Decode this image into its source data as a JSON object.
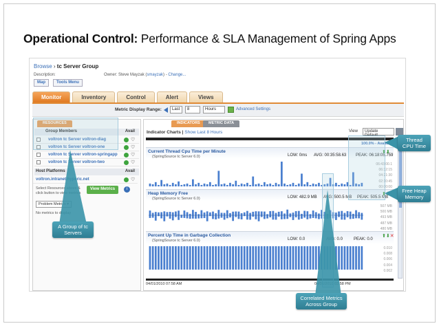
{
  "slide": {
    "title_bold": "Operational Control:",
    "title_rest": " Performance & SLA Management of Spring Apps"
  },
  "app": {
    "breadcrumb": {
      "browse": "Browse",
      "separator": " › ",
      "current": "tc Server Group"
    },
    "description_label": "Description:",
    "owner": {
      "label": "Owner: Steve Mayzak (",
      "user": "smayzak",
      "mid": ") - ",
      "change": "Change..."
    },
    "buttons": {
      "map": "Map",
      "tools_menu": "Tools Menu"
    },
    "tabs": [
      "Monitor",
      "Inventory",
      "Control",
      "Alert",
      "Views"
    ],
    "active_tab": 0,
    "range": {
      "label": "Metric Display Range:",
      "last": "Last",
      "count": "8",
      "unit": "Hours",
      "advanced": "Advanced Settings"
    },
    "left": {
      "subtabs": [
        "RESOURCES"
      ],
      "group_members": {
        "header": "Group Members",
        "avail": "Avail",
        "items": [
          "voltron tc Server voltron-diag",
          "voltron tc Server voltron-one",
          "voltron tc Server voltron-springapp",
          "voltron tc Server voltron-two"
        ]
      },
      "host_platforms": {
        "header": "Host Platforms",
        "avail": "Avail",
        "items": [
          "voltron.intranet.hyperic.net"
        ]
      },
      "note": "Select Resources above & click button to view metrics",
      "view_metrics": "View Metrics",
      "problem_metrics": "Problem Metrics",
      "no_metrics": "No metrics to display"
    },
    "right": {
      "subtabs": [
        "INDICATORS",
        "METRIC DATA"
      ],
      "indicator_label": "Indicator Charts",
      "show_last": "Show Last 8 Hours",
      "view_label": "View",
      "view_value": "Update Default",
      "availability": "100.0% - Availability",
      "charts": [
        {
          "title": "Current Thread Cpu Time per Minute",
          "sub": "(SpringSource tc Server 6.0)",
          "low": "LOW: 0ms",
          "avg": "AVG: 00:35:58.63",
          "peak": "PEAK: 06:18:05.759",
          "axis": [
            "06:43:00.1",
            "06:32:15",
            "04:21:30",
            "02:10:45",
            "00:00:00"
          ],
          "values": [
            4,
            3,
            6,
            2,
            9,
            3,
            4,
            2,
            5,
            3,
            7,
            2,
            3,
            4,
            2,
            10,
            3,
            5,
            2,
            4,
            3,
            6,
            2,
            3,
            22,
            3,
            4,
            2,
            5,
            3,
            8,
            2,
            4,
            3,
            5,
            2,
            14,
            3,
            4,
            2,
            6,
            3,
            4,
            2,
            5,
            3,
            35,
            4,
            2,
            3,
            5,
            2,
            4,
            18,
            3,
            6,
            2,
            4,
            3,
            5,
            2,
            3,
            4,
            12,
            3,
            5,
            2,
            4,
            3,
            6,
            2,
            20,
            4,
            3,
            5
          ]
        },
        {
          "title": "Heap Memory Free",
          "sub": "(SpringSource tc Server 6.0)",
          "low": "LOW: 482.9 MB",
          "avg": "AVG: 500.5 MB",
          "peak": "PEAK: 505.5 MB",
          "axis": [
            "507 MB",
            "500 MB",
            "493 MB",
            "487 MB",
            "480 MB"
          ],
          "values": [
            12,
            8,
            14,
            6,
            10,
            16,
            7,
            11,
            13,
            9,
            15,
            5,
            12,
            10,
            8,
            14,
            11,
            7,
            13,
            9,
            16,
            6,
            12,
            10,
            14,
            8,
            11,
            13,
            7,
            15,
            9,
            12,
            10,
            6,
            14,
            11,
            8,
            13,
            16,
            9,
            12,
            7,
            10,
            14,
            11,
            8,
            13,
            9,
            15,
            6,
            12,
            10,
            14,
            8,
            11,
            13,
            7,
            12,
            10,
            9,
            14,
            11,
            8,
            13,
            10,
            12,
            9,
            14,
            11,
            10,
            12,
            8,
            13,
            10,
            11
          ]
        },
        {
          "title": "Percent Up Time in Garbage Collection",
          "sub": "(SpringSource tc Server 6.0)",
          "low": "LOW: 0.0",
          "avg": "AVG: 0.0",
          "peak": "PEAK: 0.0",
          "axis": [
            "0.010",
            "0.008",
            "0.006",
            "0.004",
            "0.002"
          ],
          "values": [
            30,
            30,
            30,
            30,
            30,
            30,
            30,
            30,
            30,
            30,
            30,
            30,
            30,
            30,
            30,
            30,
            30,
            30,
            30,
            30,
            30,
            30,
            30,
            30,
            30,
            30,
            30,
            30,
            30,
            30,
            30,
            30,
            30,
            30,
            30,
            30,
            30,
            30,
            30,
            30,
            30,
            30,
            30,
            30,
            30,
            30,
            30,
            30,
            30,
            30,
            30,
            30,
            30,
            30,
            30,
            30,
            30,
            30,
            30,
            30,
            30,
            30,
            30,
            30,
            30,
            30,
            30,
            30,
            30,
            30,
            30,
            30,
            30,
            30,
            30
          ]
        }
      ],
      "time_start": "04/01/2010 07:58 AM",
      "time_end": "04/01/2010 03:58 PM"
    }
  },
  "callouts": {
    "group": "A Group of tc Servers",
    "thread": "Thread CPU Time",
    "heap": "Free Heap Memory",
    "correlated": "Correlated Metrics Across Group"
  },
  "colors": {
    "accent": "#e07a22",
    "link": "#3a6fb7",
    "callout": "#3a93a8",
    "bar": "#4a7fcf"
  }
}
